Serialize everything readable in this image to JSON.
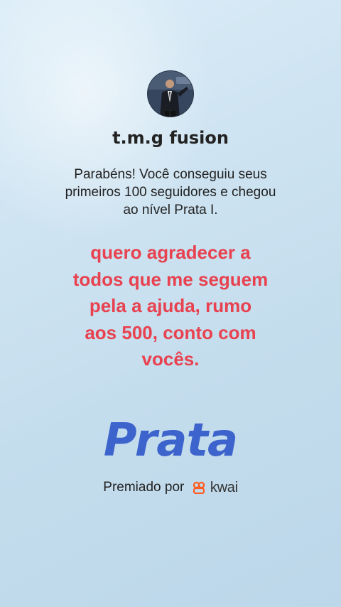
{
  "profile": {
    "username": "t.m.g fusion",
    "avatar_icon": "person-in-suit-avatar"
  },
  "achievement": {
    "message_lines": [
      "Parabéns! Você conseguiu seus",
      "primeiros 100 seguidores e chegou",
      "ao nível Prata I."
    ],
    "user_note_lines": [
      "quero agradecer a",
      "todos que me seguem",
      "pela a ajuda, rumo",
      "aos 500, conto com",
      "vocês."
    ],
    "level_name": "Prata"
  },
  "footer": {
    "awarded_by": "Premiado por",
    "brand": "kwai",
    "brand_icon": "kwai-logo-icon"
  },
  "colors": {
    "highlight": "#e8414f",
    "level": "#3d63cc",
    "brand": "#ff5a1f"
  }
}
